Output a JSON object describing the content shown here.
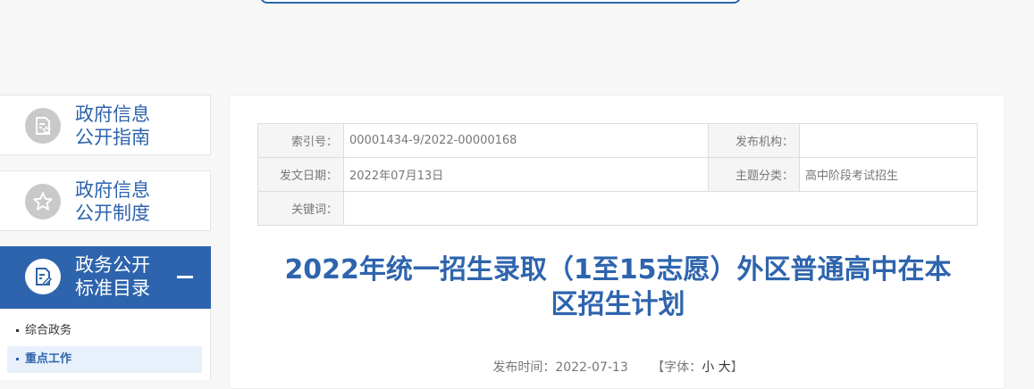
{
  "sidebar": {
    "items": [
      {
        "label_line1": "政府信息",
        "label_line2": "公开指南",
        "icon": "document-star-icon"
      },
      {
        "label_line1": "政府信息",
        "label_line2": "公开制度",
        "icon": "star-icon"
      },
      {
        "label_line1": "政务公开",
        "label_line2": "标准目录",
        "icon": "document-edit-icon",
        "active": true,
        "toggle": "−"
      }
    ],
    "sub_items": [
      {
        "label": "综合政务"
      },
      {
        "label": "重点工作",
        "active": true
      }
    ]
  },
  "meta_table": {
    "index_no_label": "索引号：",
    "index_no_value": "00001434-9/2022-00000168",
    "publisher_label": "发布机构：",
    "publisher_value": "",
    "date_label": "发文日期：",
    "date_value": "2022年07月13日",
    "category_label": "主题分类：",
    "category_value": "高中阶段考试招生",
    "keywords_label": "关键词：",
    "keywords_value": ""
  },
  "article": {
    "title_line1": "2022年统一招生录取（1至15志愿）外区普通高中在本",
    "title_line2": "区招生计划",
    "publish_time": "发布时间：2022-07-13",
    "font_size_prefix": "【字体：",
    "font_small": "小",
    "font_large": "大",
    "font_size_suffix": "】"
  },
  "colors": {
    "accent": "#2e64ad",
    "background": "#f7f7f7",
    "panel": "#ffffff"
  }
}
